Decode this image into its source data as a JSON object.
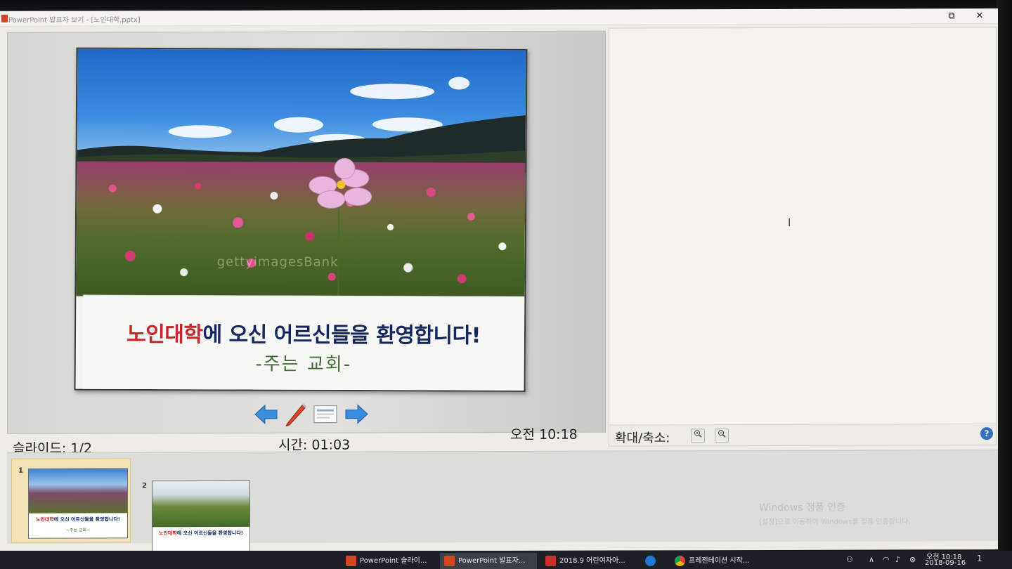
{
  "window": {
    "title": "PowerPoint 발표자 보기 - [노인대학.pptx]",
    "restore_glyph": "⧉",
    "close_glyph": "✕"
  },
  "slide": {
    "caption_red": "노인대학",
    "caption_rest": "에 오신 어르신들을 환영합니다!",
    "caption_sub": "-주는 교회-",
    "watermark": "gettyimagesBank"
  },
  "status": {
    "slide_label": "슬라이드: 1/2",
    "time_label": "시간: 01:03",
    "clock": "오전 10:18"
  },
  "notes": {
    "zoom_label": "확대/축소:",
    "help_glyph": "?"
  },
  "thumbnails": [
    {
      "number": "1",
      "caption_red": "노인대학",
      "caption_rest": "에 오신 어르신들을 환영합니다!",
      "sub": "~주는 교회~",
      "selected": true
    },
    {
      "number": "2",
      "caption_red": "노인대학",
      "caption_rest": "에 오신 어르신들을 환영합니다!",
      "sub": "",
      "selected": false
    }
  ],
  "activation": {
    "title": "Windows 정품 인증",
    "subtitle": "[설정]으로 이동하여 Windows를 정품 인증합니다."
  },
  "taskbar": {
    "tasks": [
      {
        "label": "PowerPoint 슬라이...",
        "color": "#d2461f"
      },
      {
        "label": "PowerPoint 발표자...",
        "color": "#d2461f",
        "active": true
      },
      {
        "label": "2018.9 어린여자아...",
        "color": "#c9302c"
      },
      {
        "label": "",
        "color": "#1f7ad6"
      },
      {
        "label": "프레젠테이션 시작...",
        "color": "#e7b51c"
      }
    ],
    "clock_time": "오전 10:18",
    "clock_date": "2018-09-16",
    "notification_count": "1"
  },
  "icons": {
    "prev": "arrow-left-icon",
    "pen": "pen-icon",
    "menu": "slide-menu-icon",
    "next": "arrow-right-icon",
    "zoom_in": "zoom-in-icon",
    "zoom_out": "zoom-out-icon"
  }
}
